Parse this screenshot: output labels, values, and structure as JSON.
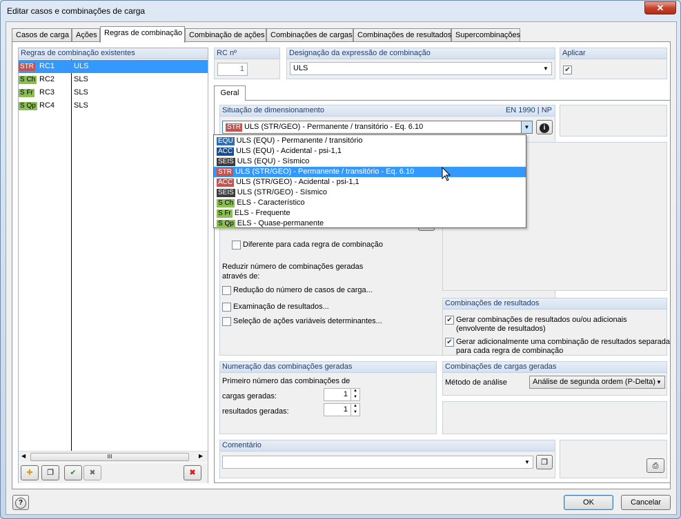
{
  "window": {
    "title": "Editar casos e combinações de carga",
    "close_glyph": "✕"
  },
  "tabs": [
    "Casos de carga",
    "Ações",
    "Regras de combinação",
    "Combinação de ações",
    "Combinações de cargas",
    "Combinações de resultados",
    "Supercombinações"
  ],
  "left_panel": {
    "header": "Regras de combinação existentes",
    "rows": [
      {
        "badge": "STR",
        "id": "RC1",
        "name": "ULS"
      },
      {
        "badge": "S Ch",
        "id": "RC2",
        "name": "SLS"
      },
      {
        "badge": "S Fr",
        "id": "RC3",
        "name": "SLS"
      },
      {
        "badge": "S Qp",
        "id": "RC4",
        "name": "SLS"
      }
    ],
    "scroll_grip": "III"
  },
  "rc_no": {
    "label": "RC nº",
    "value": "1"
  },
  "designation": {
    "label": "Designação da expressão de combinação",
    "value": "ULS"
  },
  "apply": {
    "label": "Aplicar",
    "checked": true
  },
  "sub_tab": "Geral",
  "design_situation": {
    "label": "Situação de dimensionamento",
    "standard": "EN 1990 | NP",
    "selected_badge": "STR",
    "selected": "ULS (STR/GEO) - Permanente / transitório - Eq. 6.10",
    "options": [
      {
        "badge": "EQU",
        "text": "ULS (EQU) - Permanente / transitório"
      },
      {
        "badge": "ACC",
        "text": "ULS (EQU) - Acidental - psi-1,1"
      },
      {
        "badge": "SEIS",
        "text": "ULS (EQU) - Sísmico"
      },
      {
        "badge": "STR",
        "text": "ULS (STR/GEO) - Permanente / transitório - Eq. 6.10"
      },
      {
        "badge": "ACC",
        "text": "ULS (STR/GEO) - Acidental - psi-1,1"
      },
      {
        "badge": "SEIS",
        "text": "ULS (STR/GEO) - Sísmico"
      },
      {
        "badge": "S Ch",
        "text": "ELS - Característico"
      },
      {
        "badge": "S Fr",
        "text": "ELS - Frequente"
      },
      {
        "badge": "S Qp",
        "text": "ELS - Quase-permanente"
      }
    ],
    "info_glyph": "i"
  },
  "different_each": "Diferente para cada regra de combinação",
  "reduce": {
    "label_line1": "Reduzir número de combinações geradas",
    "label_line2": "através de:",
    "options": [
      "Redução do número de casos de carga...",
      "Examinação de resultados...",
      "Seleção de ações variáveis determinantes..."
    ]
  },
  "result_combos": {
    "header": "Combinações de resultados",
    "opt1_line1": "Gerar combinações de resultados ou/ou adicionais",
    "opt1_line2": "(envolvente de resultados)",
    "opt2_line1": "Gerar adicionalmente uma combinação de resultados separada",
    "opt2_line2": "para cada regra de combinação"
  },
  "numbering": {
    "header": "Numeração das combinações geradas",
    "first_label": "Primeiro número das combinações de",
    "load_label": "cargas geradas:",
    "load_value": "1",
    "result_label": "resultados geradas:",
    "result_value": "1"
  },
  "generated": {
    "header": "Combinações de cargas geradas",
    "method_label": "Método de análise",
    "method_value": "Análise de segunda ordem (P-Delta)"
  },
  "comment": {
    "header": "Comentário",
    "value": ""
  },
  "footer": {
    "help_glyph": "?",
    "ok": "OK",
    "cancel": "Cancelar"
  },
  "colors": {
    "selection": "#3399ff",
    "header_text": "#1c3e6e",
    "str": "#c05653",
    "serviceability": "#8cbf53"
  }
}
